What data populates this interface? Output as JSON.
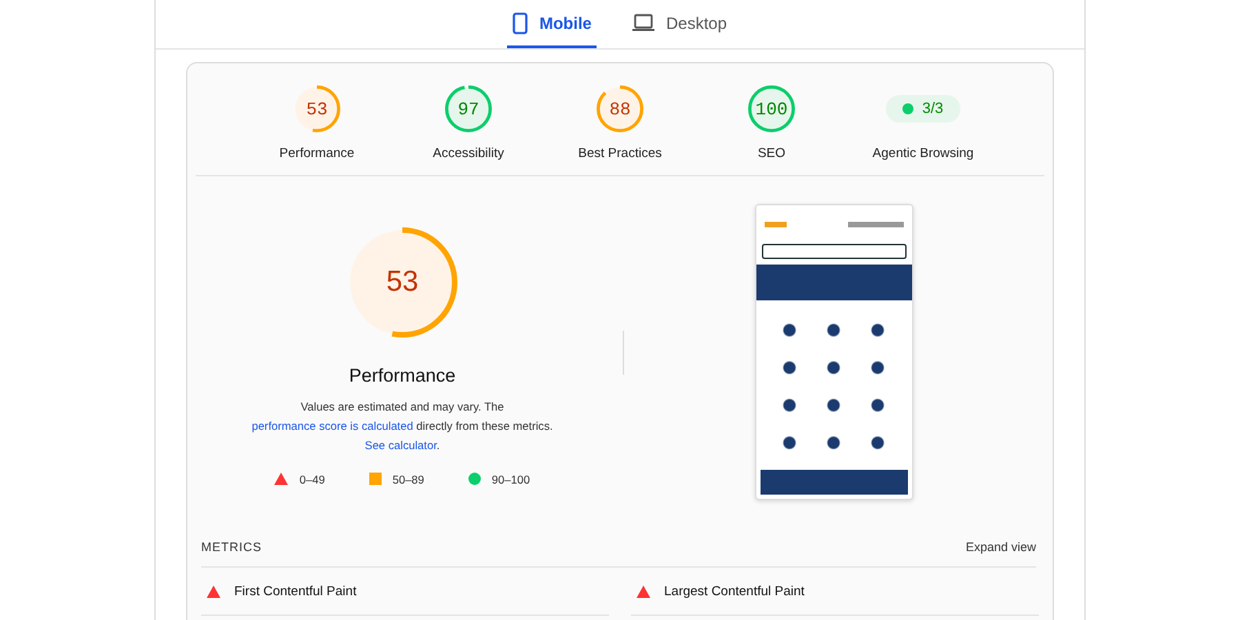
{
  "tabs": [
    {
      "label": "Mobile",
      "kind": "phone",
      "selected": true
    },
    {
      "label": "Desktop",
      "kind": "laptop",
      "selected": false
    }
  ],
  "categories": [
    {
      "kind": "gauge",
      "score": "53",
      "level": 0.53,
      "color": "#ffa400",
      "label": "Performance"
    },
    {
      "kind": "gauge",
      "score": "97",
      "level": 0.97,
      "color": "#0cce6b",
      "label": "Accessibility"
    },
    {
      "kind": "gauge",
      "score": "88",
      "level": 0.88,
      "color": "#ffa400",
      "label": "Best Practices"
    },
    {
      "kind": "gauge",
      "score": "100",
      "level": 1,
      "color": "#0cce6b",
      "label": "SEO"
    },
    {
      "kind": "badge",
      "score": "3/3",
      "color": "#0cce6b",
      "label": "Agentic Browsing"
    }
  ],
  "performance": {
    "score": "53",
    "level": 0.53,
    "color": "#ffa400",
    "title": "Performance",
    "description": [
      {
        "kind": "text",
        "text": "Values are estimated and may vary. The "
      },
      {
        "kind": "link",
        "text": "performance score is calculated"
      },
      {
        "kind": "text",
        "text": " directly from these metrics. "
      },
      {
        "kind": "link",
        "text": "See calculator"
      },
      {
        "kind": "text",
        "text": "."
      }
    ],
    "legend": [
      {
        "kind": "triangle",
        "range": "0–49"
      },
      {
        "kind": "square",
        "range": "50–89"
      },
      {
        "kind": "circle",
        "range": "90–100"
      }
    ]
  },
  "metrics": {
    "heading": "METRICS",
    "expand": "Expand view",
    "items": [
      {
        "color": "#ff3333",
        "name": "First Contentful Paint"
      },
      {
        "color": "#ff3333",
        "name": "Largest Contentful Paint"
      }
    ]
  }
}
